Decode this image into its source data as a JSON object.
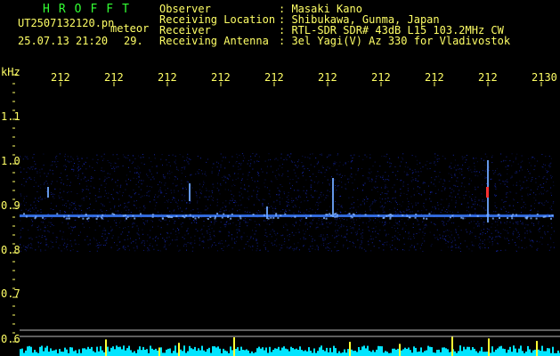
{
  "header": {
    "brand": "HROFFT",
    "filename": "UT2507132120.pn",
    "mode_label": "meteor",
    "datetime": "25.07.13 21:20",
    "count": "29.",
    "fields": [
      {
        "label": "Observer",
        "value": ": Masaki Kano"
      },
      {
        "label": "Receiving Location",
        "value": ": Shibukawa, Gunma, Japan"
      },
      {
        "label": "Receiver",
        "value": ": RTL-SDR SDR# 43dB L15 103.2MHz CW"
      },
      {
        "label": "Receiving Antenna",
        "value": ": 3el Yagi(V) Az 330 for Vladivostok"
      }
    ]
  },
  "x_axis": {
    "ticks": [
      "212",
      "212",
      "212",
      "212",
      "212",
      "212",
      "212",
      "212",
      "212",
      "2130"
    ]
  },
  "y_axis": {
    "unit": "kHz",
    "ticks": [
      "1.1",
      "1.0",
      "0.9",
      "0.8",
      "0.7",
      "0.6"
    ]
  },
  "colors": {
    "text": "#ffff66",
    "brand": "#33ff33",
    "noise_band": "#1a2fd0",
    "carrier_line": "#3a7bff",
    "axis_tick": "#ffff66",
    "bottom_lines": "#bbbbbb",
    "bottom_bars": "#00e5ff",
    "bottom_spikes": "#ffff33",
    "meteor_red": "#ff3030"
  }
}
